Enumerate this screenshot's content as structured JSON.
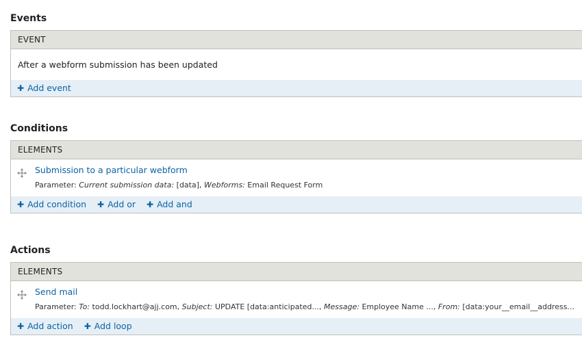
{
  "events": {
    "title": "Events",
    "header": "EVENT",
    "row_text": "After a webform submission has been updated",
    "actions": [
      "Add event"
    ]
  },
  "conditions": {
    "title": "Conditions",
    "header": "ELEMENTS",
    "element": {
      "label": "Submission to a particular webform",
      "param_prefix": "Parameter:",
      "param1_name": "Current submission data:",
      "param1_value": "[data],",
      "param2_name": "Webforms:",
      "param2_value": "Email Request Form"
    },
    "actions": [
      "Add condition",
      "Add or",
      "Add and"
    ]
  },
  "actions_section": {
    "title": "Actions",
    "header": "ELEMENTS",
    "element": {
      "label": "Send mail",
      "param_prefix": "Parameter:",
      "p1_name": "To:",
      "p1_value": "todd.lockhart@ajj.com,",
      "p2_name": "Subject:",
      "p2_value": "UPDATE [data:anticipated...,",
      "p3_name": "Message:",
      "p3_value": "Employee Name ...,",
      "p4_name": "From:",
      "p4_value": "[data:your__email__address..."
    },
    "actions": [
      "Add action",
      "Add loop"
    ]
  },
  "icons": {
    "drag": "move-arrows-icon",
    "add": "plus-icon"
  },
  "colors": {
    "link": "#0b63a5",
    "header_bg": "#e2e2dc",
    "footer_bg": "#e6eff6",
    "border": "#bfbfba"
  }
}
